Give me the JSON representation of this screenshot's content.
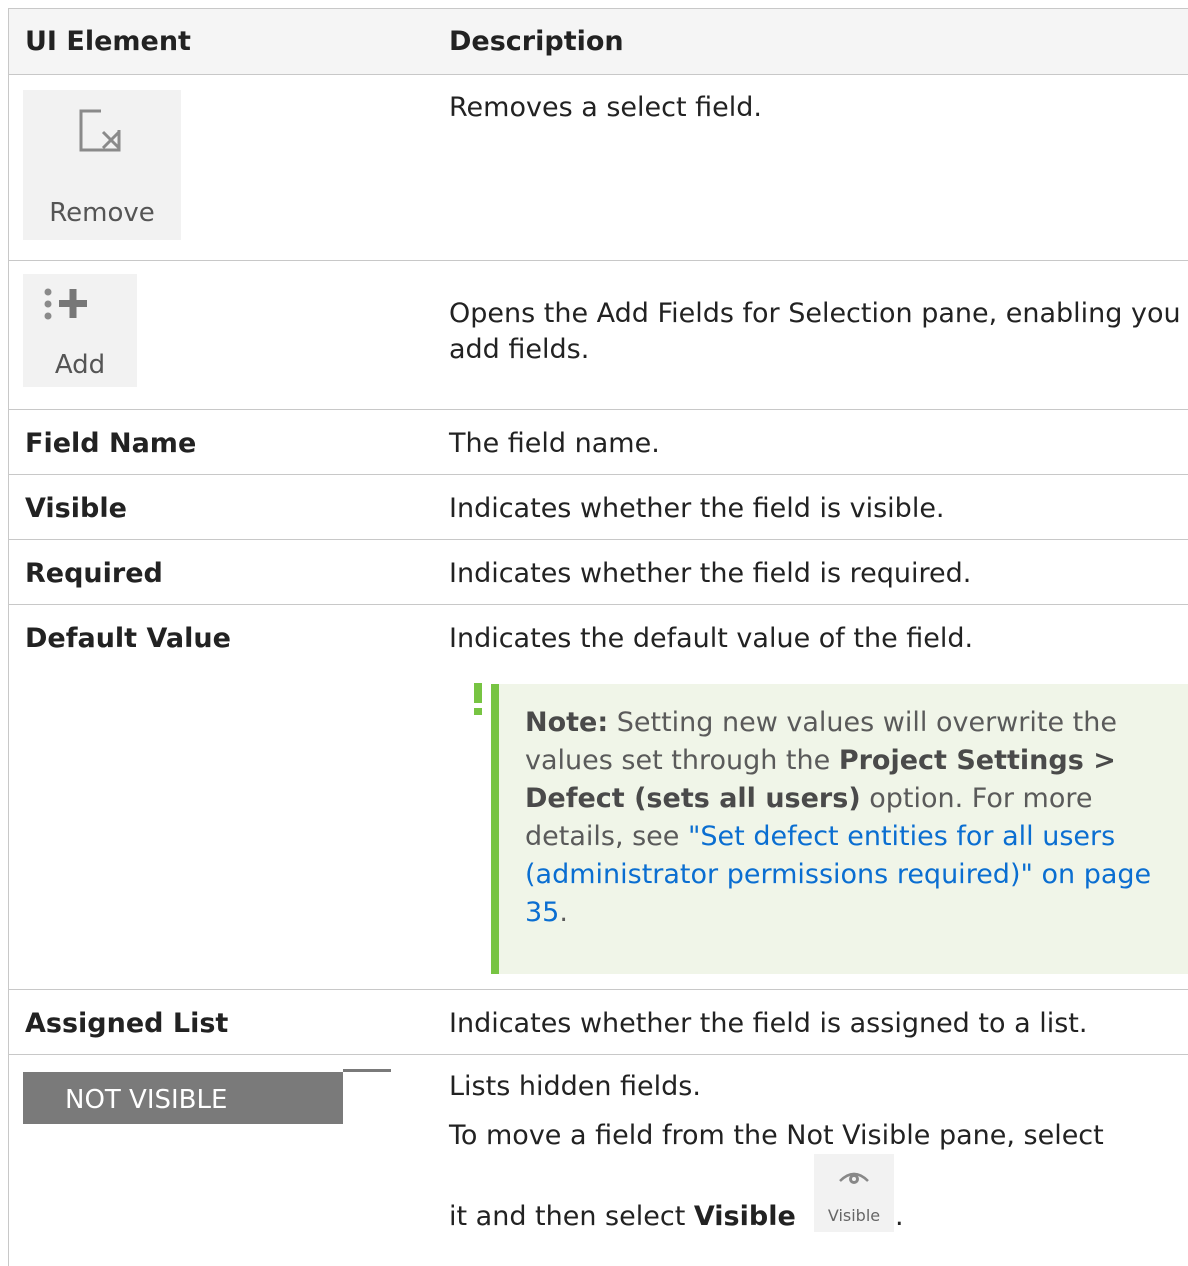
{
  "table": {
    "headers": {
      "ui_element": "UI Element",
      "description": "Description"
    },
    "rows": {
      "remove": {
        "icon": "remove-icon",
        "label": "Remove",
        "description": "Removes a select field."
      },
      "add": {
        "icon": "add-fields-icon",
        "label": "Add",
        "description": "Opens the Add Fields for Selection pane, enabling you add fields."
      },
      "field_name": {
        "element": "Field Name",
        "description": "The field name."
      },
      "visible": {
        "element": "Visible",
        "description": "Indicates whether the field is visible."
      },
      "required": {
        "element": "Required",
        "description": "Indicates whether the field is required."
      },
      "default_value": {
        "element": "Default Value",
        "description": "Indicates the default value of the field.",
        "note": {
          "icon": "exclamation-icon",
          "label": "Note:",
          "text_1": " Setting new values will overwrite the values set through the ",
          "bold": "Project Settings > Defect (sets all users)",
          "text_2": " option. For more details, see ",
          "link": "\"Set defect entities for all users (administrator permissions required)\" on page 35",
          "text_3": "."
        }
      },
      "assigned_list": {
        "element": "Assigned List",
        "description": "Indicates whether the field is assigned to a list."
      },
      "not_visible": {
        "element": "NOT VISIBLE",
        "description_1": "Lists hidden fields.",
        "description_2": "To move a field from the Not Visible pane, select",
        "description_3": "it and then select ",
        "bold": "Visible",
        "icon": "eye-icon",
        "icon_label": "Visible",
        "end": "."
      }
    }
  },
  "colors": {
    "note_bar": "#77c442",
    "note_bg": "#f0f5e8",
    "link": "#0a6ed1",
    "grid": "#c8c8c8"
  }
}
